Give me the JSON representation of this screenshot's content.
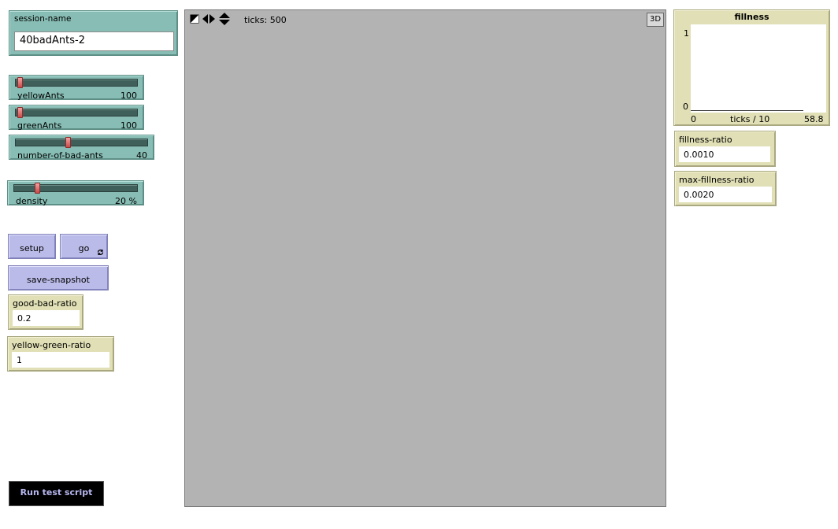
{
  "session_name": {
    "label": "session-name",
    "value": "40badAnts-2"
  },
  "sliders": [
    {
      "name": "yellowAnts",
      "value": "100",
      "fraction": 0.02
    },
    {
      "name": "greenAnts",
      "value": "100",
      "fraction": 0.02
    },
    {
      "name": "number-of-bad-ants",
      "value": "40",
      "fraction": 0.38
    },
    {
      "name": "density",
      "value": "20 %",
      "fraction": 0.18
    }
  ],
  "buttons": {
    "setup": "setup",
    "go": "go",
    "go_forever_icon": "forever-icon",
    "save_snapshot": "save-snapshot",
    "run_test_script": "Run test script"
  },
  "monitors": {
    "good_bad_ratio": {
      "label": "good-bad-ratio",
      "value": "0.2"
    },
    "yellow_green_ratio": {
      "label": "yellow-green-ratio",
      "value": "1"
    },
    "fillness_ratio": {
      "label": "fillness-ratio",
      "value": "0.0010"
    },
    "max_fillness_ratio": {
      "label": "max-fillness-ratio",
      "value": "0.0020"
    }
  },
  "view": {
    "ticks_label": "ticks: 500",
    "three_d_label": "3D",
    "toolbar_icons": [
      "wrap-icon",
      "left-right-icon",
      "up-down-icon"
    ],
    "background_color": "#b3b3b3"
  },
  "plot": {
    "title": "fillness",
    "y_max_label": "1",
    "y_min_label": "0",
    "x_min_label": "0",
    "x_axis_label": "ticks / 10",
    "x_max_label": "58.8"
  },
  "colors": {
    "input_teal": "#87bdb4",
    "button_lavender": "#babbe8",
    "monitor_khaki": "#e0dfb5",
    "slider_thumb": "#d96060"
  }
}
